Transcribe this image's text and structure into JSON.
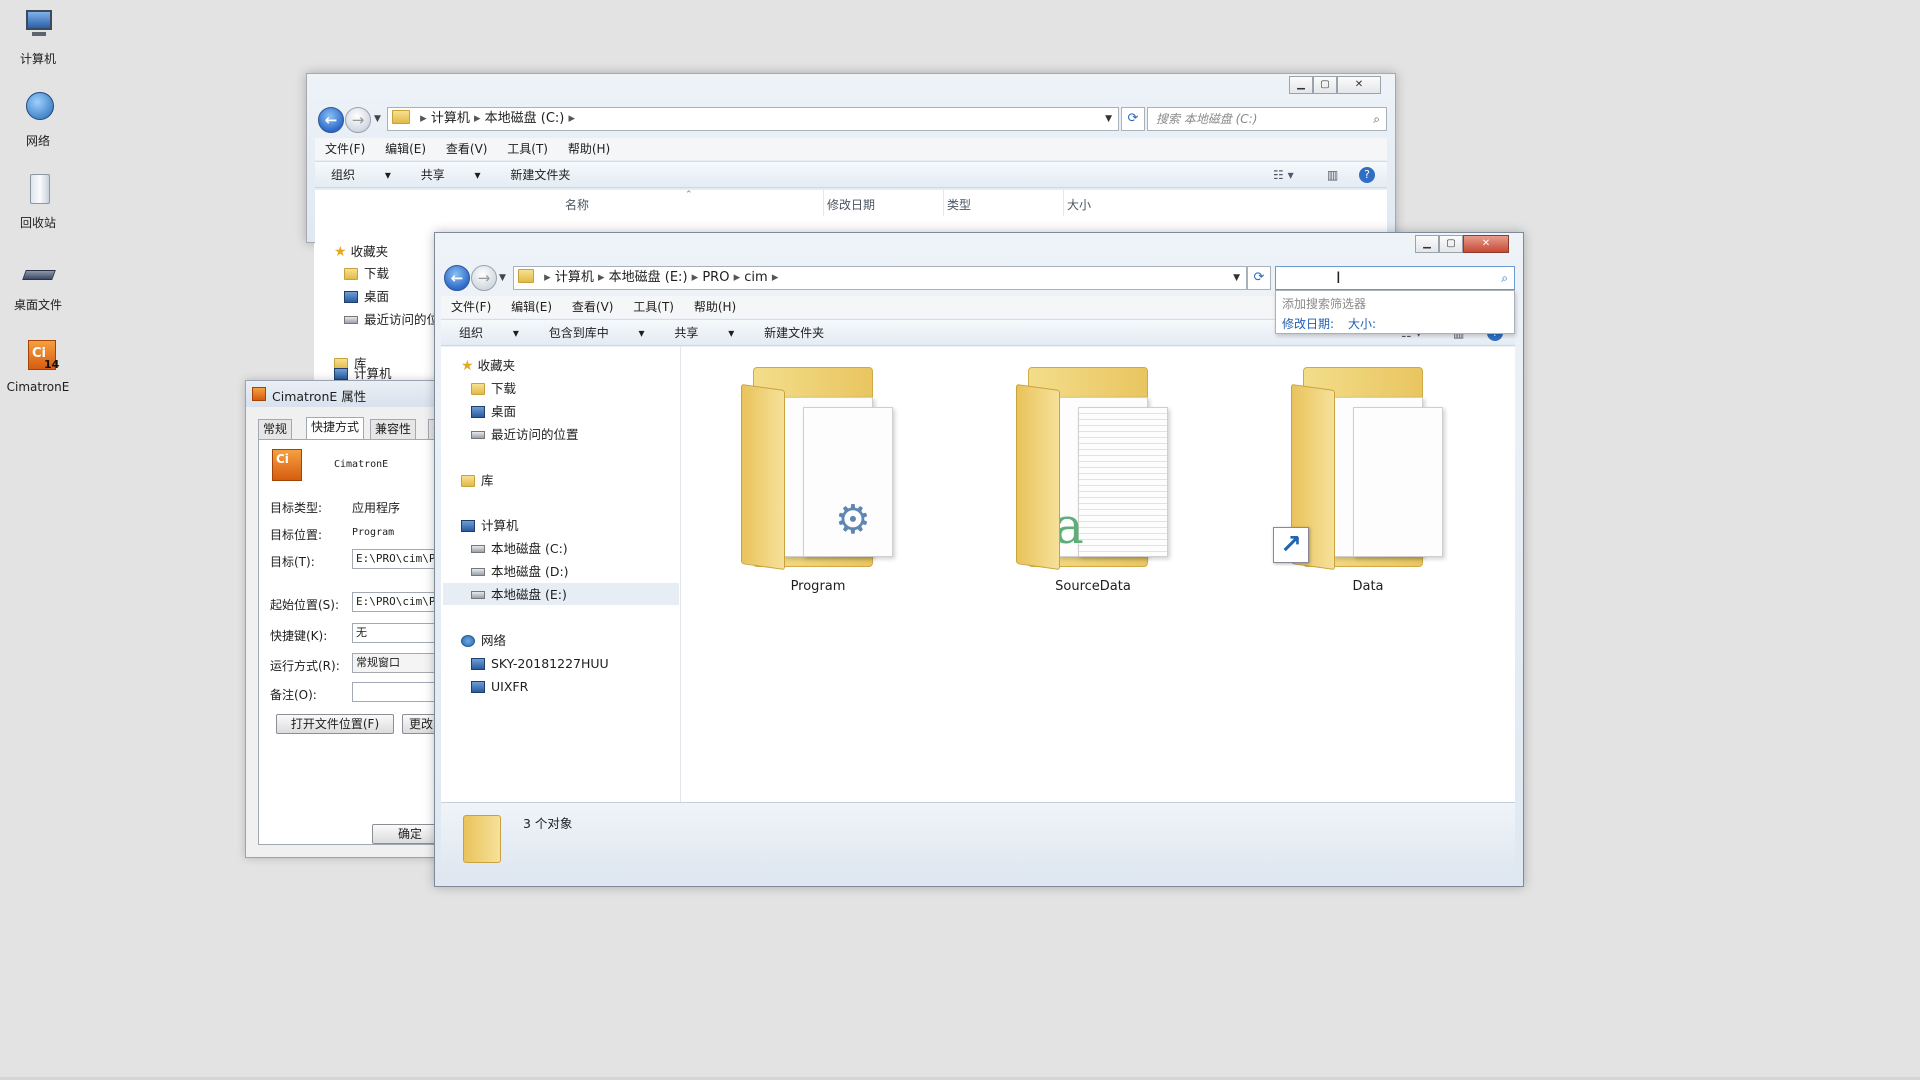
{
  "desktop": {
    "icons": [
      {
        "label": "计算机",
        "icon": "computer-icon"
      },
      {
        "label": "网络",
        "icon": "network-icon"
      },
      {
        "label": "回收站",
        "icon": "recycle-bin-icon"
      },
      {
        "label": "桌面文件",
        "icon": "desktop-files-icon"
      },
      {
        "label": "CimatronE",
        "icon": "cimatron-icon"
      }
    ]
  },
  "back_window": {
    "address": {
      "seg1": "计算机",
      "seg2": "本地磁盘 (C:)"
    },
    "search_placeholder": "搜索 本地磁盘 (C:)",
    "menu": [
      "文件(F)",
      "编辑(E)",
      "查看(V)",
      "工具(T)",
      "帮助(H)"
    ],
    "commands": {
      "organize": "组织",
      "share": "共享",
      "new_folder": "新建文件夹"
    },
    "columns": [
      "名称",
      "修改日期",
      "类型",
      "大小"
    ],
    "nav": {
      "favorites": "收藏夹",
      "downloads": "下载",
      "desktop": "桌面",
      "recent": "最近访问的位",
      "libraries": "库",
      "computer": "计算机"
    }
  },
  "properties": {
    "title": "CimatronE 属性",
    "tabs": [
      "常规",
      "快捷方式",
      "兼容性",
      "安"
    ],
    "app_name": "CimatronE",
    "fields": {
      "target_type_label": "目标类型:",
      "target_type": "应用程序",
      "target_location_label": "目标位置:",
      "target_location": "Program",
      "target_label": "目标(T):",
      "target": "E:\\PRO\\cim\\Pr",
      "start_in_label": "起始位置(S):",
      "start_in": "E:\\PRO\\cim\\Pr",
      "hotkey_label": "快捷键(K):",
      "hotkey": "无",
      "run_label": "运行方式(R):",
      "run": "常规窗口",
      "comment_label": "备注(O):",
      "comment": ""
    },
    "buttons": {
      "open_location": "打开文件位置(F)",
      "change_icon": "更改图",
      "ok": "确定"
    }
  },
  "front_window": {
    "address": {
      "seg1": "计算机",
      "seg2": "本地磁盘 (E:)",
      "seg3": "PRO",
      "seg4": "cim"
    },
    "search_value": "",
    "search_dropdown": {
      "title": "添加搜索筛选器",
      "filter1": "修改日期:",
      "filter2": "大小:"
    },
    "menu": [
      "文件(F)",
      "编辑(E)",
      "查看(V)",
      "工具(T)",
      "帮助(H)"
    ],
    "commands": {
      "organize": "组织",
      "include": "包含到库中",
      "share": "共享",
      "new_folder": "新建文件夹"
    },
    "nav": {
      "favorites": "收藏夹",
      "downloads": "下载",
      "desktop": "桌面",
      "recent": "最近访问的位置",
      "libraries": "库",
      "computer": "计算机",
      "drive_c": "本地磁盘 (C:)",
      "drive_d": "本地磁盘 (D:)",
      "drive_e": "本地磁盘 (E:)",
      "network": "网络",
      "net1": "SKY-20181227HUU",
      "net2": "UIXFR"
    },
    "items": [
      {
        "name": "Program",
        "icon": "folder-program-icon"
      },
      {
        "name": "SourceData",
        "icon": "folder-sourcedata-icon"
      },
      {
        "name": "Data",
        "icon": "folder-shortcut-icon"
      }
    ],
    "status": "3 个对象"
  }
}
